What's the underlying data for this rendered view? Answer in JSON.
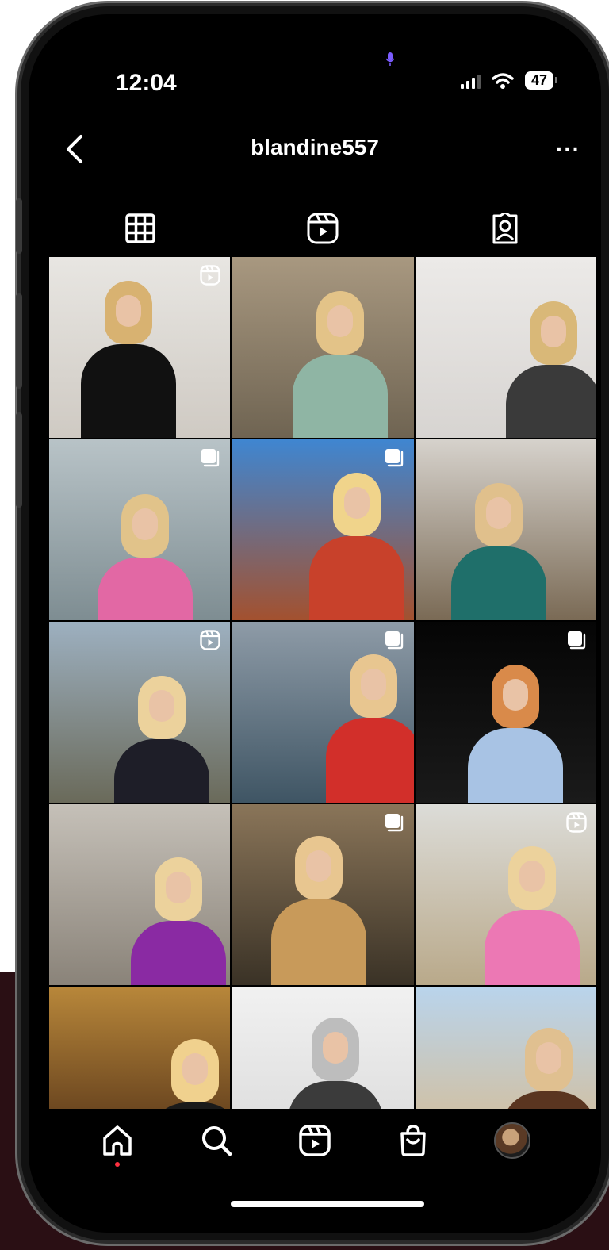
{
  "status_bar": {
    "time": "12:04",
    "battery": "47"
  },
  "header": {
    "title": "blandine557",
    "more": "···"
  },
  "tabs": [
    {
      "icon": "grid-icon",
      "active": true
    },
    {
      "icon": "reels-icon",
      "active": false
    },
    {
      "icon": "tagged-icon",
      "active": false
    }
  ],
  "posts": [
    {
      "type": "reel",
      "bg": [
        "#e8e6e2",
        "#cfcac3"
      ],
      "accent": "#d8b271",
      "garment": "#111111"
    },
    {
      "type": "photo",
      "bg": [
        "#a89880",
        "#6f6452"
      ],
      "accent": "#e3c388",
      "garment": "#8fb5a4"
    },
    {
      "type": "photo",
      "bg": [
        "#eceae8",
        "#d7d4d1"
      ],
      "accent": "#d9b878",
      "garment": "#3a3a3a"
    },
    {
      "type": "carousel",
      "bg": [
        "#b8c3c7",
        "#7e8d92"
      ],
      "accent": "#e1c38a",
      "garment": "#e268a4"
    },
    {
      "type": "carousel",
      "bg": [
        "#3f86d1",
        "#a3512f"
      ],
      "accent": "#f0d48b",
      "garment": "#c8412b"
    },
    {
      "type": "photo",
      "bg": [
        "#d6d2cc",
        "#7a6a55"
      ],
      "accent": "#e0c08c",
      "garment": "#1f6f6a"
    },
    {
      "type": "reel",
      "bg": [
        "#9db0c0",
        "#6a6a5a"
      ],
      "accent": "#ecd29c",
      "garment": "#1e1e28"
    },
    {
      "type": "carousel",
      "bg": [
        "#8e9ba7",
        "#3f5564"
      ],
      "accent": "#e8c690",
      "garment": "#d22f2a"
    },
    {
      "type": "carousel",
      "bg": [
        "#050505",
        "#1a1a1a"
      ],
      "accent": "#d98a4a",
      "garment": "#a8c3e4"
    },
    {
      "type": "photo",
      "bg": [
        "#c5c0b8",
        "#8a8379"
      ],
      "accent": "#ecd29c",
      "garment": "#8a2aa3"
    },
    {
      "type": "carousel",
      "bg": [
        "#8a7559",
        "#3a3226"
      ],
      "accent": "#e8c690",
      "garment": "#c89a5a"
    },
    {
      "type": "reel",
      "bg": [
        "#dcdcd8",
        "#b9a98a"
      ],
      "accent": "#ecd29c",
      "garment": "#ec78b4"
    },
    {
      "type": "photo",
      "bg": [
        "#b8873a",
        "#4a2a14"
      ],
      "accent": "#f0d18e",
      "garment": "#1a1a1a"
    },
    {
      "type": "photo",
      "bg": [
        "#f1f1f1",
        "#d8d8d8"
      ],
      "accent": "#bdbdbd",
      "garment": "#3b3b3b"
    },
    {
      "type": "photo",
      "bg": [
        "#b9d4ec",
        "#d9b98a"
      ],
      "accent": "#e0c090",
      "garment": "#5a3520"
    }
  ],
  "bottom_nav": [
    {
      "icon": "home-icon",
      "active": true
    },
    {
      "icon": "search-icon",
      "active": false
    },
    {
      "icon": "reels-icon",
      "active": false
    },
    {
      "icon": "shop-icon",
      "active": false
    },
    {
      "icon": "profile-avatar",
      "active": false
    }
  ]
}
